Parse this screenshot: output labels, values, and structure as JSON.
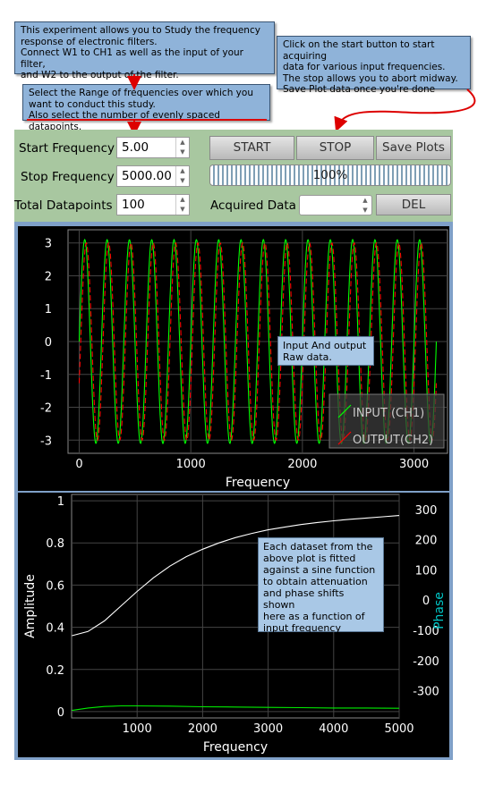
{
  "notes": {
    "intro": "This experiment allows you to Study the frequency\nresponse of electronic filters.\nConnect W1 to CH1 as well as the input of your filter,\nand W2 to the output of the filter.",
    "start_help": "Click on the start button to start acquiring\ndata for various input frequencies.\nThe stop allows you to abort midway.\nSave Plot data once you're done",
    "range_help": "Select the Range of frequencies over which you\nwant to conduct this study.\nAlso select the number of evenly spaced datapoints.",
    "raw_data": "Input And output\nRaw data.",
    "fit_info": "Each dataset from the\nabove plot is fitted\nagainst a sine function\nto obtain attenuation\nand phase shifts shown\nhere as a function of\ninput frequency"
  },
  "controls": {
    "start_freq_label": "Start Frequency",
    "start_freq_value": "5.00",
    "stop_freq_label": "Stop Frequency",
    "stop_freq_value": "5000.00",
    "datapoints_label": "Total Datapoints",
    "datapoints_value": "100",
    "acquired_label": "Acquired Data",
    "acquired_value": "",
    "start_button": "START",
    "stop_button": "STOP",
    "save_button": "Save Plots",
    "del_button": "DEL",
    "progress_text": "100%",
    "progress_value": 100
  },
  "colors": {
    "note_bg": "#8fb3d9",
    "panel_bg": "#a8c7a0",
    "input_trace": "#00ff00",
    "output_trace": "#ff0000",
    "amplitude_trace": "#ffffff",
    "phase_trace": "#00ee00",
    "phase_label": "#00c8c8",
    "arrow": "#dd0000"
  },
  "chart_data": [
    {
      "type": "line",
      "title": "",
      "xlabel": "Frequency",
      "ylabel": "",
      "xlim": [
        -100,
        3300
      ],
      "ylim": [
        -3.4,
        3.4
      ],
      "x_ticks": [
        0,
        1000,
        2000,
        3000
      ],
      "y_ticks": [
        3,
        2,
        1,
        0,
        -1,
        -2,
        -3
      ],
      "grid": true,
      "legend": "bottom-right",
      "series": [
        {
          "name": "INPUT (CH1)",
          "color": "#00ff00",
          "amplitude": 3.1,
          "cycles": 16,
          "phase_deg": 0
        },
        {
          "name": "OUTPUT(CH2)",
          "color": "#ff0000",
          "amplitude": 3.0,
          "cycles": 16,
          "phase_deg": -25
        }
      ]
    },
    {
      "type": "line",
      "title": "",
      "xlabel": "Frequency",
      "ylabel": "Amplitude",
      "y2label": "Phase",
      "xlim": [
        0,
        5000
      ],
      "ylim": [
        -0.03,
        1.03
      ],
      "y2lim": [
        -390,
        350
      ],
      "x_ticks": [
        1000,
        2000,
        3000,
        4000,
        5000
      ],
      "y_ticks": [
        0,
        0.2,
        0.4,
        0.6,
        0.8,
        1
      ],
      "y2_ticks": [
        300,
        200,
        100,
        0,
        -100,
        -200,
        -300
      ],
      "grid": true,
      "series": [
        {
          "name": "",
          "axis": "left",
          "color": "#ffffff",
          "x": [
            5,
            250,
            500,
            750,
            1000,
            1250,
            1500,
            1750,
            2000,
            2250,
            2500,
            2750,
            3000,
            3250,
            3500,
            3750,
            4000,
            4250,
            4500,
            4750,
            5000
          ],
          "y": [
            0.36,
            0.38,
            0.43,
            0.5,
            0.57,
            0.635,
            0.69,
            0.735,
            0.77,
            0.8,
            0.825,
            0.845,
            0.862,
            0.875,
            0.887,
            0.897,
            0.905,
            0.912,
            0.918,
            0.924,
            0.93
          ]
        },
        {
          "name": "",
          "axis": "right",
          "color": "#00ee00",
          "x": [
            5,
            250,
            500,
            750,
            1000,
            1500,
            2000,
            2500,
            3000,
            3500,
            4000,
            4500,
            5000
          ],
          "y": [
            -365,
            -357,
            -352,
            -350,
            -350,
            -351,
            -353,
            -354,
            -355,
            -356,
            -357,
            -357,
            -358
          ]
        }
      ]
    }
  ]
}
